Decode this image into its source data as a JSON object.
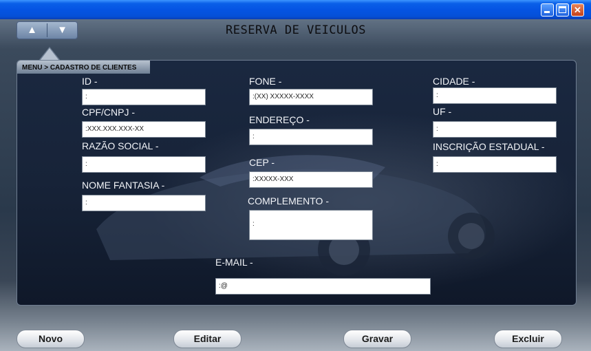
{
  "window": {
    "title_text": "",
    "controls": [
      "minimize-icon",
      "maximize-icon",
      "close-icon"
    ]
  },
  "nav": {
    "up_glyph": "▲",
    "down_glyph": "▼"
  },
  "app": {
    "title": "RESERVA DE VEICULOS"
  },
  "breadcrumb": {
    "text": "MENU > CADASTRO DE CLIENTES"
  },
  "form": {
    "id": {
      "label": "ID -",
      "value": ":"
    },
    "cpf": {
      "label": "CPF/CNPJ -",
      "value": ":XXX.XXX.XXX-XX"
    },
    "razao": {
      "label": "RAZÃO SOCIAL -",
      "value": ":"
    },
    "fantasia": {
      "label": "NOME FANTASIA -",
      "value": ":"
    },
    "fone": {
      "label": "FONE -",
      "value": ":(XX) XXXXX-XXXX"
    },
    "endereco": {
      "label": "ENDEREÇO -",
      "value": ":"
    },
    "cep": {
      "label": "CEP -",
      "value": ":XXXXX-XXX"
    },
    "complemento": {
      "label": "COMPLEMENTO -",
      "value": ":"
    },
    "cidade": {
      "label": "CIDADE -",
      "value": ":"
    },
    "uf": {
      "label": "UF -",
      "value": ":"
    },
    "inscricao": {
      "label": "INSCRIÇÃO ESTADUAL -",
      "value": ":"
    },
    "email": {
      "label": "E-MAIL -",
      "value": ":@"
    }
  },
  "actions": {
    "novo": "Novo",
    "editar": "Editar",
    "gravar": "Gravar",
    "excluir": "Excluir"
  },
  "colors": {
    "titlebar": "#0554e3",
    "panel": "#172338",
    "label_text": "#f2f4f8"
  }
}
